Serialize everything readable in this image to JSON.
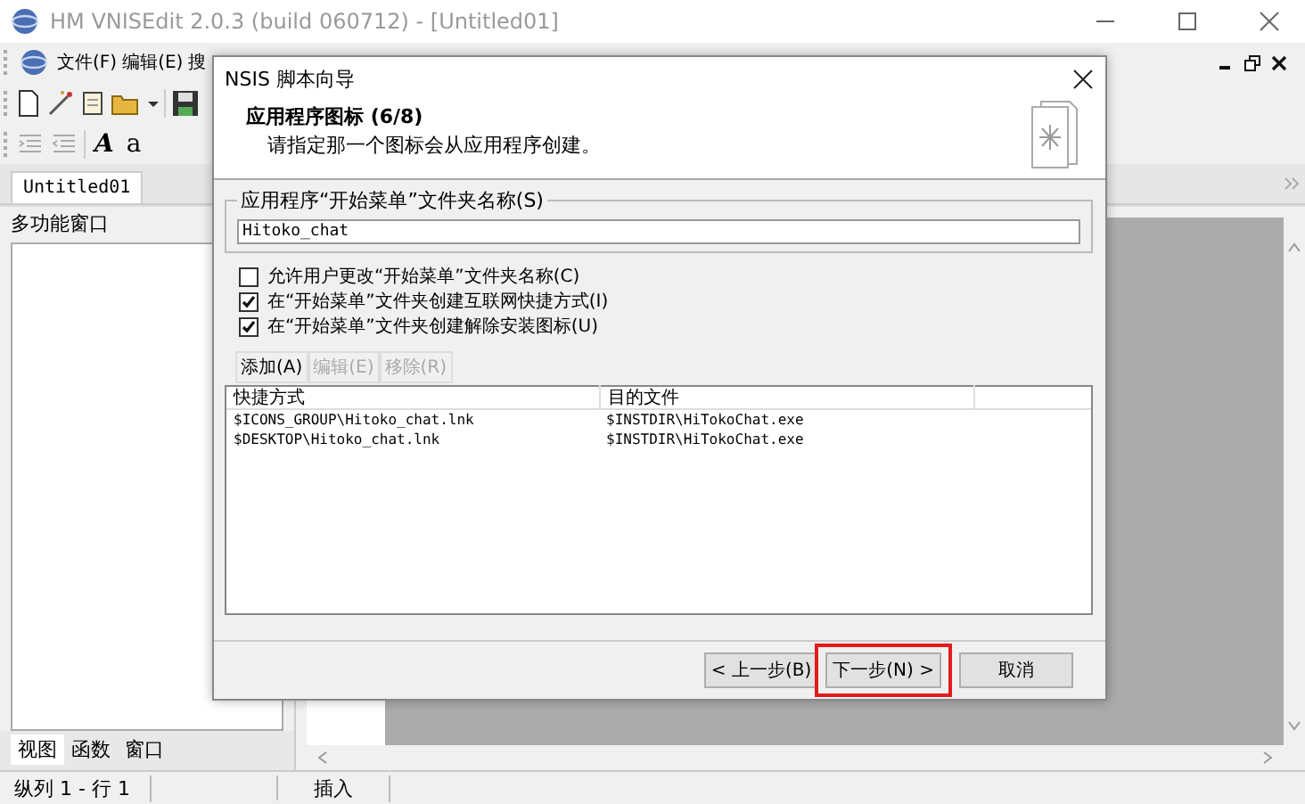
{
  "window": {
    "title": "HM VNISEdit 2.0.3 (build 060712) - [Untitled01]"
  },
  "menu": [
    {
      "label": "文件(F)"
    },
    {
      "label": "编辑(E)"
    },
    {
      "label": "搜"
    }
  ],
  "format_toolbar": [
    {
      "glyph": "A",
      "kind": "italic"
    },
    {
      "glyph": "a",
      "kind": "plain"
    }
  ],
  "document_tabs": [
    {
      "label": "Untitled01",
      "selected": true
    }
  ],
  "side_panel": {
    "title": "多功能窗口",
    "tabs": [
      {
        "label": "视图",
        "selected": true
      },
      {
        "label": "函数",
        "selected": false
      },
      {
        "label": "窗口",
        "selected": false
      }
    ]
  },
  "status_bar": {
    "position": "纵列 1 - 行 1",
    "mode": "插入"
  },
  "dialog": {
    "title": "NSIS 脚本向导",
    "heading": "应用程序图标 (6/8)",
    "subtitle": "请指定那一个图标会从应用程序创建。",
    "folder_group": {
      "label": "应用程序“开始菜单”文件夹名称(S)",
      "value": "Hitoko_chat"
    },
    "options": [
      {
        "label": "允许用户更改“开始菜单”文件夹名称(C)",
        "checked": false
      },
      {
        "label": "在“开始菜单”文件夹创建互联网快捷方式(I)",
        "checked": true
      },
      {
        "label": "在“开始菜单”文件夹创建解除安装图标(U)",
        "checked": true
      }
    ],
    "list_buttons": [
      {
        "label": "添加(A)",
        "disabled": false
      },
      {
        "label": "编辑(E)",
        "disabled": true
      },
      {
        "label": "移除(R)",
        "disabled": true
      }
    ],
    "shortcuts": {
      "columns": [
        "快捷方式",
        "目的文件"
      ],
      "rows": [
        [
          "$ICONS_GROUP\\Hitoko_chat.lnk",
          "$INSTDIR\\HiTokoChat.exe"
        ],
        [
          "$DESKTOP\\Hitoko_chat.lnk",
          "$INSTDIR\\HiTokoChat.exe"
        ]
      ]
    },
    "buttons": [
      {
        "label": "< 上一步(B)",
        "highlighted": false
      },
      {
        "label": "下一步(N) >",
        "highlighted": true
      },
      {
        "label": "取消",
        "highlighted": false
      }
    ]
  }
}
